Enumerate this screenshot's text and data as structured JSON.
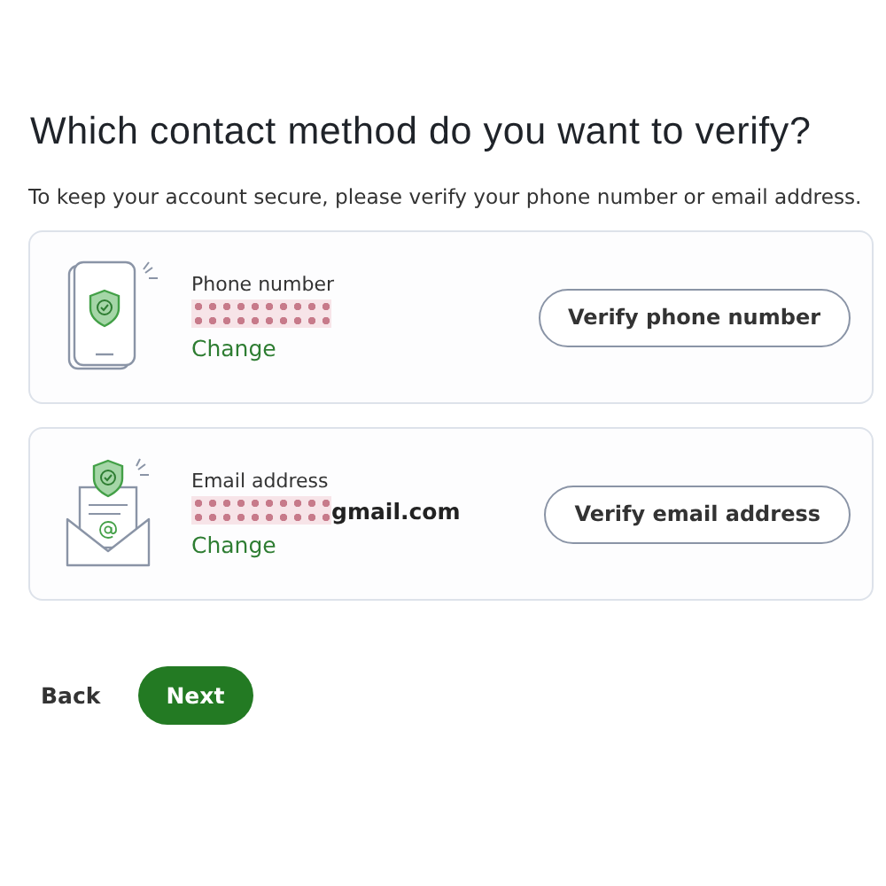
{
  "heading": "Which contact method do you want to verify?",
  "intro": "To keep your account secure, please verify your phone number or email address.",
  "methods": [
    {
      "kind": "phone",
      "label": "Phone number",
      "masked": true,
      "change": "Change",
      "button": "Verify phone number"
    },
    {
      "kind": "email",
      "label": "Email address",
      "masked": true,
      "value": "gmail.com",
      "change": "Change",
      "button": "Verify email address"
    }
  ],
  "actions": {
    "back": "Back",
    "next": "Next"
  }
}
